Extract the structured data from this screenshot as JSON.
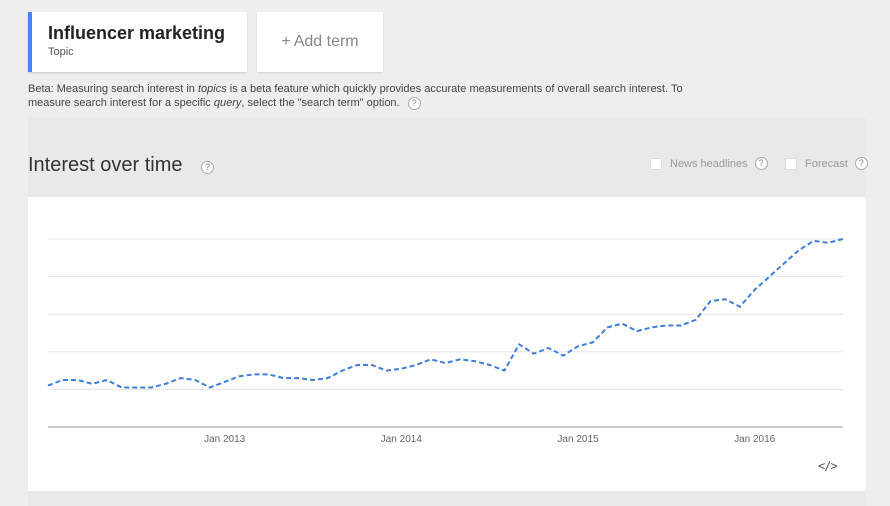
{
  "term": {
    "title": "Influencer marketing",
    "subtitle": "Topic"
  },
  "add_term": {
    "plus": "+",
    "label": "Add term"
  },
  "beta": {
    "p1": "Beta: Measuring search interest in ",
    "topics": "topics",
    "p2": " is a beta feature which quickly provides accurate measurements of overall search interest. To measure search interest for a specific ",
    "query": "query",
    "p3": ", select the \"search term\" option."
  },
  "section": {
    "title": "Interest over time"
  },
  "options": {
    "news": "News headlines",
    "forecast": "Forecast"
  },
  "icons": {
    "help": "?",
    "embed": "</>"
  },
  "colors": {
    "accent": "#4285f4",
    "line": "#3e7ee0"
  },
  "chart_data": {
    "type": "line",
    "title": "",
    "xlabel": "",
    "ylabel": "",
    "x_start": 2012.0,
    "x_step": 0.0833333,
    "xlim": [
      2012.0,
      2016.5
    ],
    "ylim": [
      0,
      100
    ],
    "x_ticks": [
      {
        "label": "Jan 2013",
        "value": 2013.0
      },
      {
        "label": "Jan 2014",
        "value": 2014.0
      },
      {
        "label": "Jan 2015",
        "value": 2015.0
      },
      {
        "label": "Jan 2016",
        "value": 2016.0
      }
    ],
    "y_gridlines": [
      20,
      40,
      60,
      80,
      100
    ],
    "series": [
      {
        "dashed": true,
        "values": [
          22,
          25,
          25,
          23,
          25,
          21,
          21,
          21,
          23,
          26,
          25,
          21,
          24,
          27,
          28,
          28,
          26,
          26,
          25,
          26,
          30,
          33,
          33,
          30,
          31,
          33,
          36,
          34,
          36,
          35,
          33,
          30,
          44,
          39,
          42,
          38,
          43,
          45,
          53,
          55,
          51,
          53,
          54,
          54,
          57,
          67,
          68,
          64,
          73,
          80,
          87,
          94,
          99,
          98,
          100
        ]
      }
    ]
  }
}
